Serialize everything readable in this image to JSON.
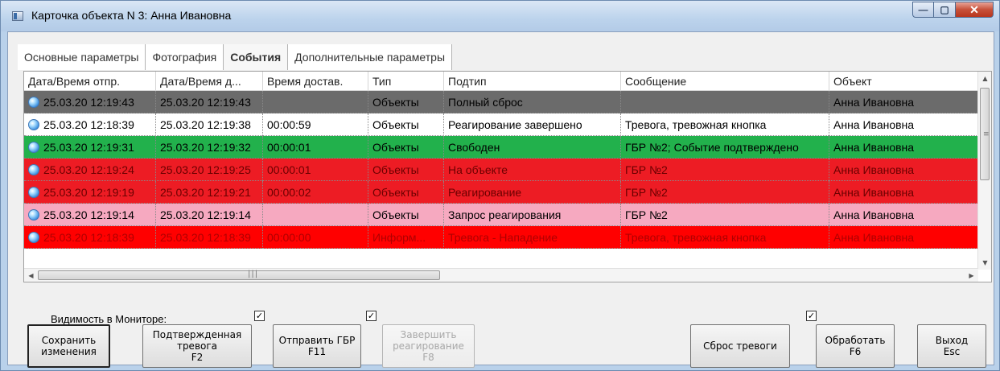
{
  "window": {
    "title": "Карточка объекта N 3: Анна Ивановна",
    "min_glyph": "—",
    "max_glyph": "▢",
    "close_glyph": "✕"
  },
  "tabs": [
    {
      "label": "Основные параметры",
      "active": false
    },
    {
      "label": "Фотография",
      "active": false
    },
    {
      "label": "События",
      "active": true
    },
    {
      "label": "Дополнительные параметры",
      "active": false
    }
  ],
  "grid": {
    "columns": [
      "Дата/Время отпр.",
      "Дата/Время д...",
      "Время достав.",
      "Тип",
      "Подтип",
      "Сообщение",
      "Объект"
    ],
    "rows": [
      {
        "bg": "#6b6b6b",
        "fg": "#000000",
        "cells": [
          "25.03.20 12:19:43",
          "25.03.20 12:19:43",
          "",
          "Объекты",
          "Полный сброс",
          "",
          "Анна Ивановна"
        ]
      },
      {
        "bg": "#ffffff",
        "fg": "#000000",
        "cells": [
          "25.03.20 12:18:39",
          "25.03.20 12:19:38",
          "00:00:59",
          "Объекты",
          "Реагирование завершено",
          "Тревога, тревожная кнопка",
          "Анна Ивановна"
        ]
      },
      {
        "bg": "#22b14c",
        "fg": "#000000",
        "cells": [
          "25.03.20 12:19:31",
          "25.03.20 12:19:32",
          "00:00:01",
          "Объекты",
          "Свободен",
          "ГБР №2; Событие подтверждено",
          "Анна Ивановна"
        ]
      },
      {
        "bg": "#ed1c24",
        "fg": "#6b0000",
        "cells": [
          "25.03.20 12:19:24",
          "25.03.20 12:19:25",
          "00:00:01",
          "Объекты",
          "На объекте",
          "ГБР №2",
          "Анна Ивановна"
        ]
      },
      {
        "bg": "#ed1c24",
        "fg": "#6b0000",
        "cells": [
          "25.03.20 12:19:19",
          "25.03.20 12:19:21",
          "00:00:02",
          "Объекты",
          "Реагирование",
          "ГБР №2",
          "Анна Ивановна"
        ]
      },
      {
        "bg": "#f6a9c0",
        "fg": "#000000",
        "cells": [
          "25.03.20 12:19:14",
          "25.03.20 12:19:14",
          "",
          "Объекты",
          "Запрос реагирования",
          "ГБР №2",
          "Анна Ивановна"
        ]
      },
      {
        "bg": "#ff0000",
        "fg": "#b00000",
        "cells": [
          "25.03.20 12:18:39",
          "25.03.20 12:18:39",
          "00:00:00",
          "Информ...",
          "Тревога - Нападение",
          "Тревога, тревожная кнопка",
          "Анна Ивановна"
        ]
      }
    ]
  },
  "monitor_visibility": {
    "label": "Видимость в Мониторе:",
    "check_glyph": "✓",
    "checkboxes": [
      true,
      true,
      true
    ]
  },
  "buttons": {
    "save": "Сохранить\nизменения",
    "confirmed_alarm": "Подтвержденная\nтревога\nF2",
    "send_gbr": "Отправить ГБР\nF11",
    "finish_response": "Завершить\nреагирование\nF8",
    "reset_alarm": "Сброс тревоги",
    "process": "Обработать\nF6",
    "exit": "Выход\nEsc"
  },
  "scrollbars": {
    "up_glyph": "▲",
    "down_glyph": "▼",
    "left_glyph": "◀",
    "right_glyph": "▶",
    "v_grip": "≡",
    "h_grip": "|||"
  }
}
